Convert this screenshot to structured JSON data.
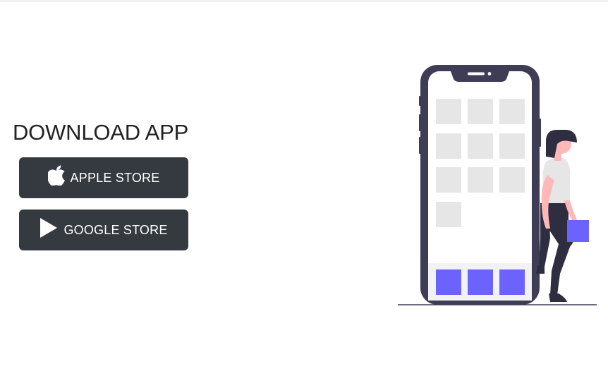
{
  "download": {
    "heading": "DOWNLOAD APP",
    "apple_button": {
      "label": "APPLE STORE",
      "icon": "apple-icon"
    },
    "google_button": {
      "label": "GOOGLE STORE",
      "icon": "play-icon"
    }
  },
  "illustration": {
    "subject": "woman-leaning-on-phone",
    "colors": {
      "phone_frame": "#3f3d56",
      "app_tile": "#e6e6e6",
      "accent": "#6c63ff",
      "button_bg": "#343a40"
    }
  }
}
